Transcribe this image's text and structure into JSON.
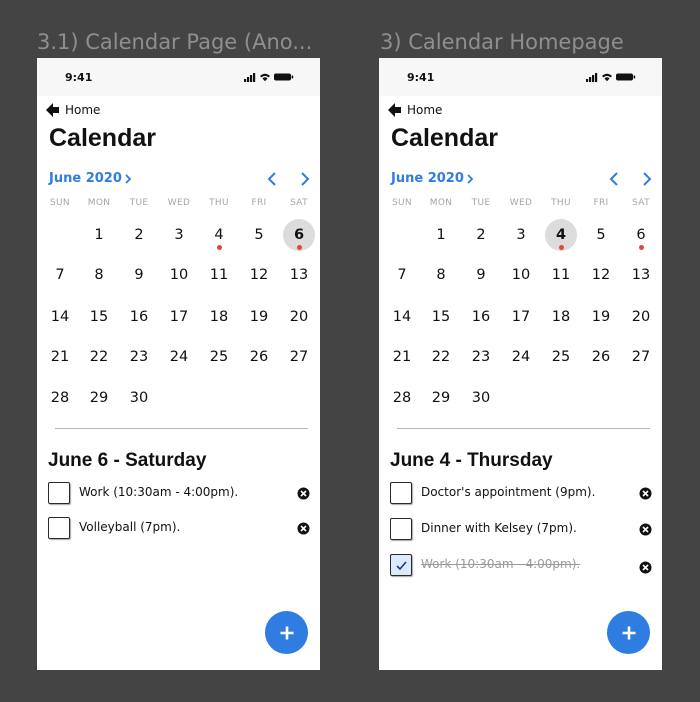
{
  "frames": [
    {
      "label": "3.1) Calendar Page (Ano...",
      "status_time": "9:41",
      "back_label": "Home",
      "title": "Calendar",
      "month_label": "June 2020",
      "weekdays": [
        "SUN",
        "MON",
        "TUE",
        "WED",
        "THU",
        "FRI",
        "SAT"
      ],
      "selected_day": "6",
      "event_dot_days": [
        "4",
        "6"
      ],
      "day_heading": "June 6 - Saturday",
      "tasks": [
        {
          "label": "Work (10:30am - 4:00pm).",
          "checked": false
        },
        {
          "label": "Volleyball (7pm).",
          "checked": false
        }
      ],
      "fab_label": "+"
    },
    {
      "label": "3) Calendar Homepage",
      "status_time": "9:41",
      "back_label": "Home",
      "title": "Calendar",
      "month_label": "June 2020",
      "weekdays": [
        "SUN",
        "MON",
        "TUE",
        "WED",
        "THU",
        "FRI",
        "SAT"
      ],
      "selected_day": "4",
      "event_dot_days": [
        "4",
        "6"
      ],
      "day_heading": "June 4 - Thursday",
      "tasks": [
        {
          "label": "Doctor's appointment (9pm).",
          "checked": false
        },
        {
          "label": "Dinner with Kelsey (7pm).",
          "checked": false
        },
        {
          "label": "Work (10:30am - 4:00pm).",
          "checked": true
        }
      ],
      "fab_label": "+"
    }
  ],
  "calendar_weeks": [
    [
      "",
      "1",
      "2",
      "3",
      "4",
      "5",
      "6"
    ],
    [
      "7",
      "8",
      "9",
      "10",
      "11",
      "12",
      "13"
    ],
    [
      "14",
      "15",
      "16",
      "17",
      "18",
      "19",
      "20"
    ],
    [
      "21",
      "22",
      "23",
      "24",
      "25",
      "26",
      "27"
    ],
    [
      "28",
      "29",
      "30",
      "",
      "",
      "",
      ""
    ]
  ],
  "colors": {
    "background": "#444444",
    "accent": "#2f7de1",
    "event_dot": "#e0463c",
    "selected_day_bg": "#dcdcdc"
  },
  "icons": {
    "back": "back-arrow-icon",
    "month_chevron": "chevron-right-icon",
    "prev": "chevron-left-icon",
    "next": "chevron-right-icon",
    "delete": "close-circle-icon",
    "add": "plus-icon",
    "status": [
      "signal-icon",
      "wifi-icon",
      "battery-icon"
    ]
  }
}
